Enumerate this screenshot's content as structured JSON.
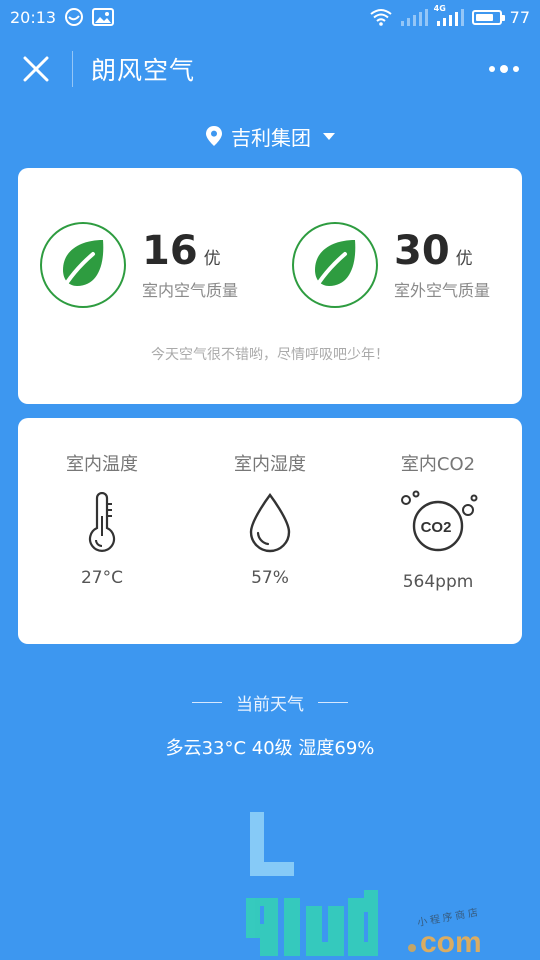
{
  "status_bar": {
    "time": "20:13",
    "battery": "77",
    "battery_level": 0.77,
    "network_label": "4G"
  },
  "nav": {
    "title": "朗风空气"
  },
  "location": {
    "name": "吉利集团"
  },
  "air_quality": {
    "indoor": {
      "value": "16",
      "level": "优",
      "label": "室内空气质量"
    },
    "outdoor": {
      "value": "30",
      "level": "优",
      "label": "室外空气质量"
    },
    "tip": "今天空气很不错哟，尽情呼吸吧少年！"
  },
  "environment": {
    "temperature": {
      "label": "室内温度",
      "value": "27°C",
      "icon": "thermometer-icon"
    },
    "humidity": {
      "label": "室内湿度",
      "value": "57%",
      "icon": "water-drop-icon"
    },
    "co2": {
      "label": "室内CO2",
      "value": "564ppm",
      "icon": "co2-icon",
      "icon_text": "CO2"
    }
  },
  "weather": {
    "heading": "当前天气",
    "summary": "多云33°C 40级 湿度69%"
  },
  "watermark": {
    "text": "91ud.com",
    "sub": "小 程 序 商 店"
  },
  "colors": {
    "background": "#3d97f0",
    "leaf_green": "#2e9c40",
    "card": "#ffffff"
  }
}
